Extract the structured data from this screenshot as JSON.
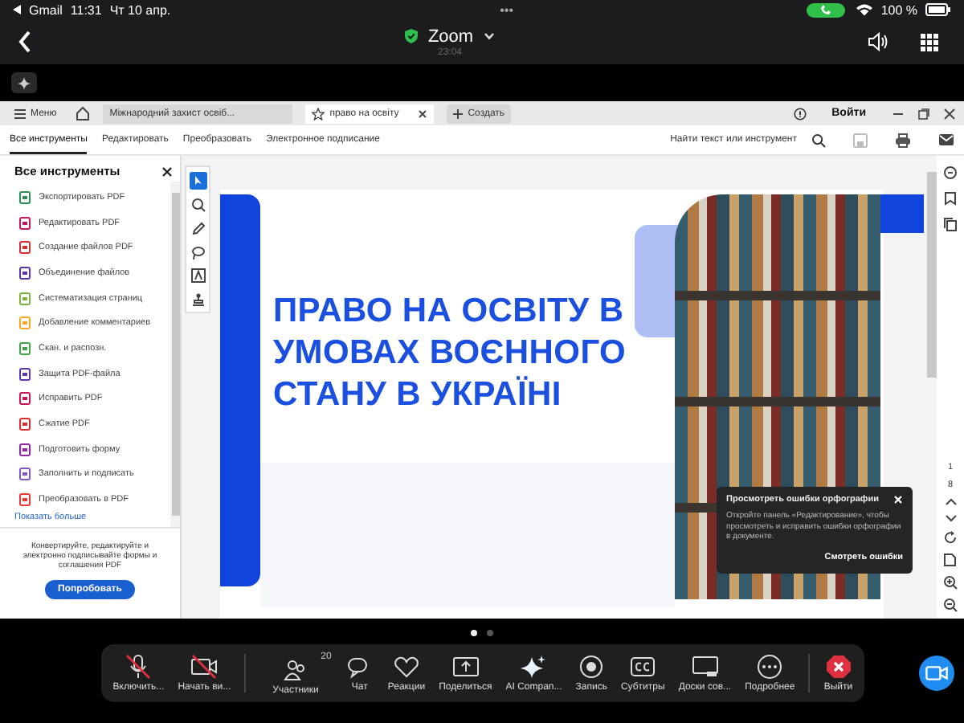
{
  "status_bar": {
    "back_app": "Gmail",
    "time": "11:31",
    "date": "Чт 10 апр.",
    "dots": "•••",
    "battery": "100 %"
  },
  "meeting": {
    "title": "Zoom",
    "timer": "23:04"
  },
  "acrobat": {
    "menu_button": "Меню",
    "tabs": [
      {
        "label": "Міжнародний захист освіб...",
        "selected": false
      },
      {
        "label": "право на освіту",
        "selected": true
      }
    ],
    "new_tab": "Создать",
    "rail_marks": [
      "1",
      "8"
    ],
    "sign_in": "Войти",
    "toolbar_tabs": [
      {
        "label": "Все инструменты",
        "selected": true
      },
      {
        "label": "Редактировать",
        "selected": false
      },
      {
        "label": "Преобразовать",
        "selected": false
      },
      {
        "label": "Электронное подписание",
        "selected": false
      }
    ],
    "search": {
      "placeholder": "Найти текст или инструмент"
    },
    "panel": {
      "title": "Все инструменты",
      "tools": [
        {
          "label": "Экспортировать PDF",
          "color": "#2e8b57"
        },
        {
          "label": "Редактировать PDF",
          "color": "#c2185b"
        },
        {
          "label": "Создание файлов PDF",
          "color": "#d32f2f"
        },
        {
          "label": "Объединение файлов",
          "color": "#5e35b1"
        },
        {
          "label": "Систематизация страниц",
          "color": "#7cb342"
        },
        {
          "label": "Добавление комментариев",
          "color": "#f9a825"
        },
        {
          "label": "Скан. и распозн.",
          "color": "#43a047"
        },
        {
          "label": "Защита PDF-файла",
          "color": "#5e35b1"
        },
        {
          "label": "Исправить PDF",
          "color": "#c2185b"
        },
        {
          "label": "Сжатие PDF",
          "color": "#d32f2f"
        },
        {
          "label": "Подготовить форму",
          "color": "#8e24aa"
        },
        {
          "label": "Заполнить и подписать",
          "color": "#7e57c2"
        },
        {
          "label": "Преобразовать в PDF",
          "color": "#e53935"
        }
      ],
      "show_more": "Показать больше",
      "promo": "Конвертируйте, редактируйте и электронно подписывайте формы и соглашения PDF",
      "try_button": "Попробовать"
    },
    "document": {
      "title": "ПРАВО НА ОСВІТУ В УМОВАХ ВОЄННОГО СТАНУ В УКРАЇНІ"
    },
    "popup": {
      "title": "Просмотреть ошибки орфографии",
      "body": "Откройте панель «Редактирование», чтобы просмотреть и исправить ошибки орфографии в документе.",
      "action": "Смотреть ошибки"
    }
  },
  "pager": [
    {
      "selected": true
    },
    {
      "selected": false
    }
  ],
  "controls": [
    {
      "label": "Включить...",
      "kind": "mic",
      "off": true
    },
    {
      "label": "Начать ви...",
      "kind": "video",
      "off": true
    },
    {
      "label": "Участники",
      "kind": "people",
      "off": false,
      "badge": "20"
    },
    {
      "label": "Чат",
      "kind": "chat",
      "off": false
    },
    {
      "label": "Реакции",
      "kind": "heart",
      "off": false
    },
    {
      "label": "Поделиться",
      "kind": "share",
      "off": false
    },
    {
      "label": "AI Compan...",
      "kind": "sparkle",
      "off": false
    },
    {
      "label": "Запись",
      "kind": "record",
      "off": false
    },
    {
      "label": "Субтитры",
      "kind": "cc",
      "off": false
    },
    {
      "label": "Доски сов...",
      "kind": "board",
      "off": false
    },
    {
      "label": "Подробнее",
      "kind": "more",
      "off": false
    },
    {
      "label": "Выйти",
      "kind": "leave",
      "off": false
    }
  ]
}
